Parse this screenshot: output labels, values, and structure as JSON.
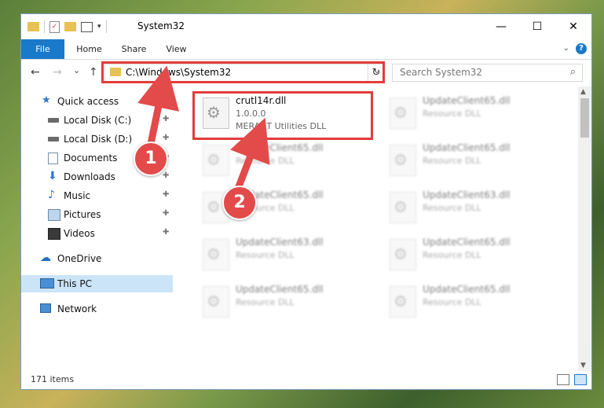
{
  "window": {
    "title": "System32",
    "minimize_glyph": "—",
    "maximize_glyph": "☐",
    "close_glyph": "✕"
  },
  "ribbon": {
    "tabs": [
      "File",
      "Home",
      "Share",
      "View"
    ],
    "help_glyph": "?"
  },
  "navigation": {
    "back_glyph": "←",
    "forward_glyph": "→",
    "recent_glyph": "⌄",
    "up_glyph": "↑",
    "address": "C:\\Windows\\System32",
    "refresh_glyph": "↻",
    "search_placeholder": "Search System32"
  },
  "sidebar": {
    "items": [
      {
        "label": "Quick access",
        "icon": "star-icon",
        "pinned": false
      },
      {
        "label": "Local Disk (C:)",
        "icon": "drive-icon",
        "pinned": true
      },
      {
        "label": "Local Disk (D:)",
        "icon": "drive-icon",
        "pinned": true
      },
      {
        "label": "Documents",
        "icon": "documents-icon",
        "pinned": true
      },
      {
        "label": "Downloads",
        "icon": "download-icon",
        "pinned": true
      },
      {
        "label": "Music",
        "icon": "music-icon",
        "pinned": true
      },
      {
        "label": "Pictures",
        "icon": "pictures-icon",
        "pinned": true
      },
      {
        "label": "Videos",
        "icon": "videos-icon",
        "pinned": true
      },
      {
        "label": "OneDrive",
        "icon": "cloud-icon",
        "pinned": false
      },
      {
        "label": "This PC",
        "icon": "computer-icon",
        "pinned": false,
        "selected": true
      },
      {
        "label": "Network",
        "icon": "network-icon",
        "pinned": false
      }
    ],
    "pin_glyph": "📌"
  },
  "files": [
    {
      "name": "crutl14r.dll",
      "version": "1.0.0.0",
      "description": "MERANT Utilities DLL",
      "highlighted": true
    },
    {
      "name": "UpdateClient65.dll",
      "description": "Resource DLL"
    },
    {
      "name": "UpdateClient65.dll",
      "description": "Resource DLL"
    },
    {
      "name": "UpdateClient65.dll",
      "description": "Resource DLL"
    },
    {
      "name": "UpdateClient65.dll",
      "description": "Resource DLL"
    },
    {
      "name": "UpdateClient63.dll",
      "description": "Resource DLL"
    },
    {
      "name": "UpdateClient63.dll",
      "description": "Resource DLL"
    },
    {
      "name": "UpdateClient65.dll",
      "description": "Resource DLL"
    },
    {
      "name": "UpdateClient65.dll",
      "description": "Resource DLL"
    },
    {
      "name": "UpdateClient65.dll",
      "description": "Resource DLL"
    }
  ],
  "status": {
    "item_count": "171 items"
  },
  "callouts": {
    "step1": "1",
    "step2": "2"
  },
  "colors": {
    "accent": "#1979ca",
    "highlight": "#e33c3c",
    "selection": "#cce4f7"
  }
}
